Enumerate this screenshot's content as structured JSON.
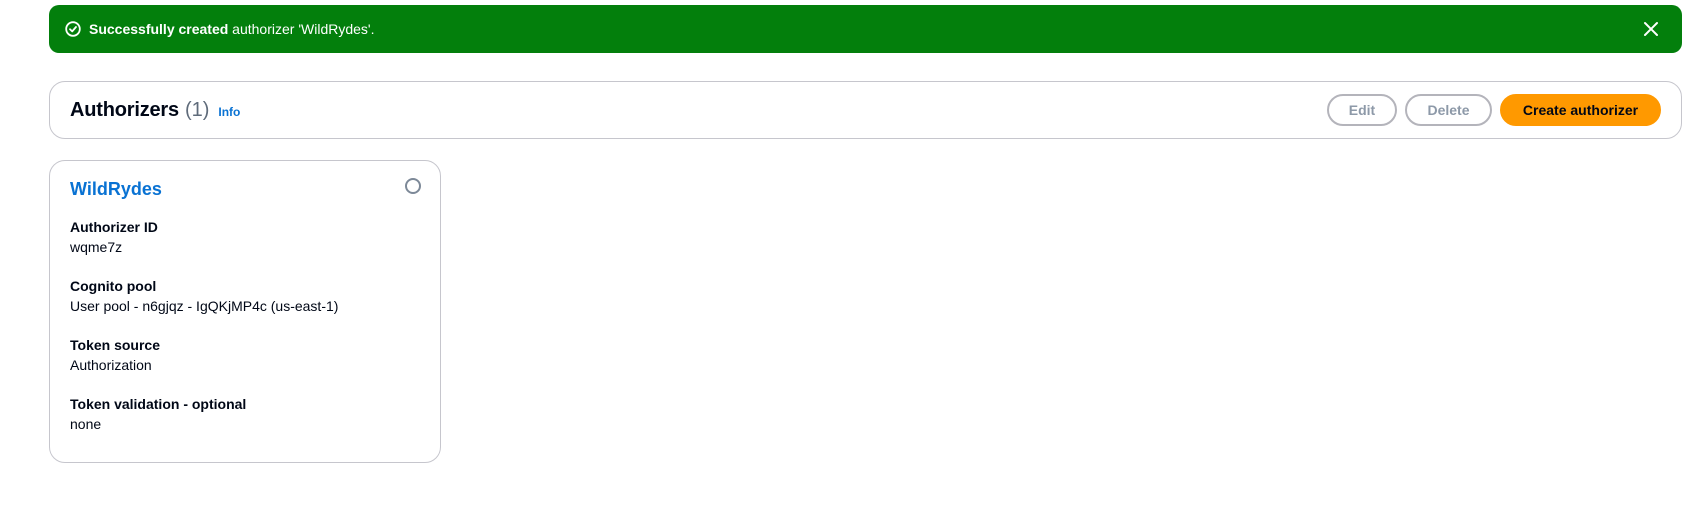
{
  "flash": {
    "bold_text": "Successfully created",
    "rest_text": " authorizer 'WildRydes'.",
    "color": "#037f0c"
  },
  "header": {
    "title": "Authorizers",
    "count": "(1)",
    "info_label": "Info",
    "buttons": {
      "edit": "Edit",
      "delete": "Delete",
      "create": "Create authorizer"
    },
    "primary_color": "#ff9900"
  },
  "card": {
    "title": "WildRydes",
    "link_color": "#0972d3",
    "fields": [
      {
        "label": "Authorizer ID",
        "value": "wqme7z"
      },
      {
        "label": "Cognito pool",
        "value": "User pool - n6gjqz - IgQKjMP4c (us-east-1)"
      },
      {
        "label": "Token source",
        "value": "Authorization"
      },
      {
        "label": "Token validation - optional",
        "value": "none"
      }
    ]
  }
}
